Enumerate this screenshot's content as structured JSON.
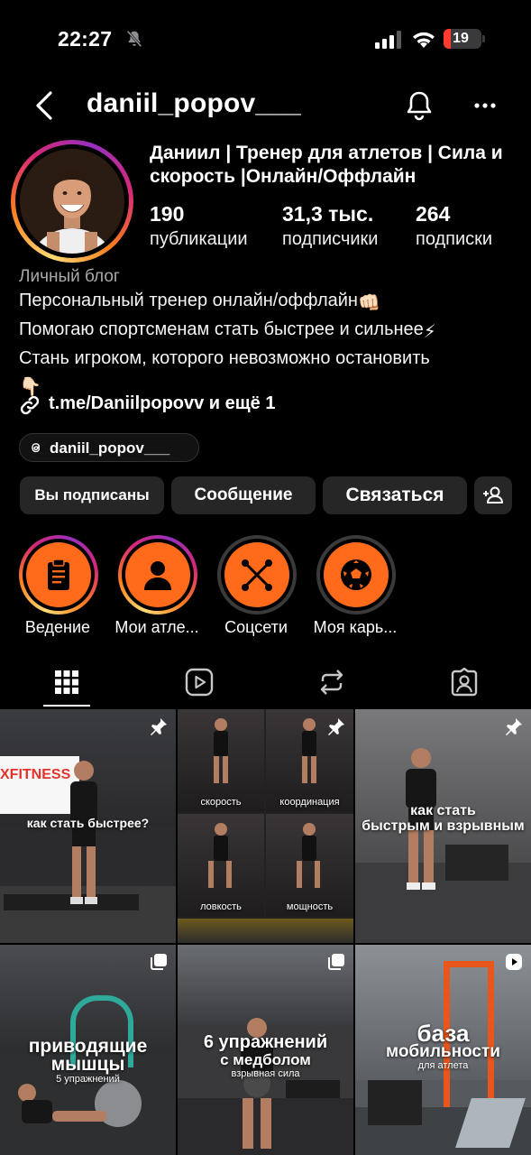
{
  "status_bar": {
    "time": "22:27",
    "battery": "19",
    "battery_level": 0.19
  },
  "header": {
    "username": "daniil_popov___"
  },
  "profile": {
    "full_name": "Даниил | Тренер для атлетов | Сила и скорость |Онлайн/Оффлайн",
    "stats": [
      {
        "value": "190",
        "label": "публикации"
      },
      {
        "value": "31,3 тыс.",
        "label": "подписчики"
      },
      {
        "value": "264",
        "label": "подписки"
      }
    ],
    "category": "Личный блог",
    "bio_lines": [
      "Персональный тренер онлайн/оффлайн",
      "Помогаю спортсменам стать быстрее и сильнее",
      "Стань игроком, которого невозможно остановить"
    ],
    "bio_emojis": [
      "👊🏻",
      "⚡",
      "👇🏻"
    ],
    "link_text": "t.me/Daniilpopovv и ещё 1",
    "threads_handle": "daniil_popov___"
  },
  "buttons": {
    "following": "Вы подписаны",
    "message": "Сообщение",
    "contact": "Связаться"
  },
  "highlights": [
    {
      "label": "Ведение",
      "icon": "clipboard-icon",
      "ring": "gradient"
    },
    {
      "label": "Мои атле...",
      "icon": "person-icon",
      "ring": "gradient"
    },
    {
      "label": "Соцсети",
      "icon": "crossed-rackets-icon",
      "ring": "gray"
    },
    {
      "label": "Моя карь...",
      "icon": "soccer-ball-icon",
      "ring": "gray"
    }
  ],
  "tabs": [
    "grid-icon",
    "reels-icon",
    "reposts-icon",
    "tagged-icon"
  ],
  "posts": [
    {
      "caption": "как стать быстрее?",
      "sign": "XFITNESS",
      "badge": "pin-icon"
    },
    {
      "captions": [
        "скорость",
        "координация",
        "ловкость",
        "мощность"
      ],
      "badge": "pin-icon"
    },
    {
      "caption_line1": "как стать",
      "caption_line2": "быстрым и взрывным",
      "badge": "pin-icon"
    },
    {
      "caption_line1": "приводящие",
      "caption_line2": "мышцы",
      "subcaption": "5 упражнений",
      "badge": "carousel-icon"
    },
    {
      "caption_line1": "6 упражнений",
      "caption_line2": "с медболом",
      "subcaption": "взрывная сила",
      "badge": "carousel-icon"
    },
    {
      "caption_line1": "база",
      "caption_line2": "мобильности",
      "subcaption": "для атлета",
      "badge": "reel-icon"
    }
  ]
}
